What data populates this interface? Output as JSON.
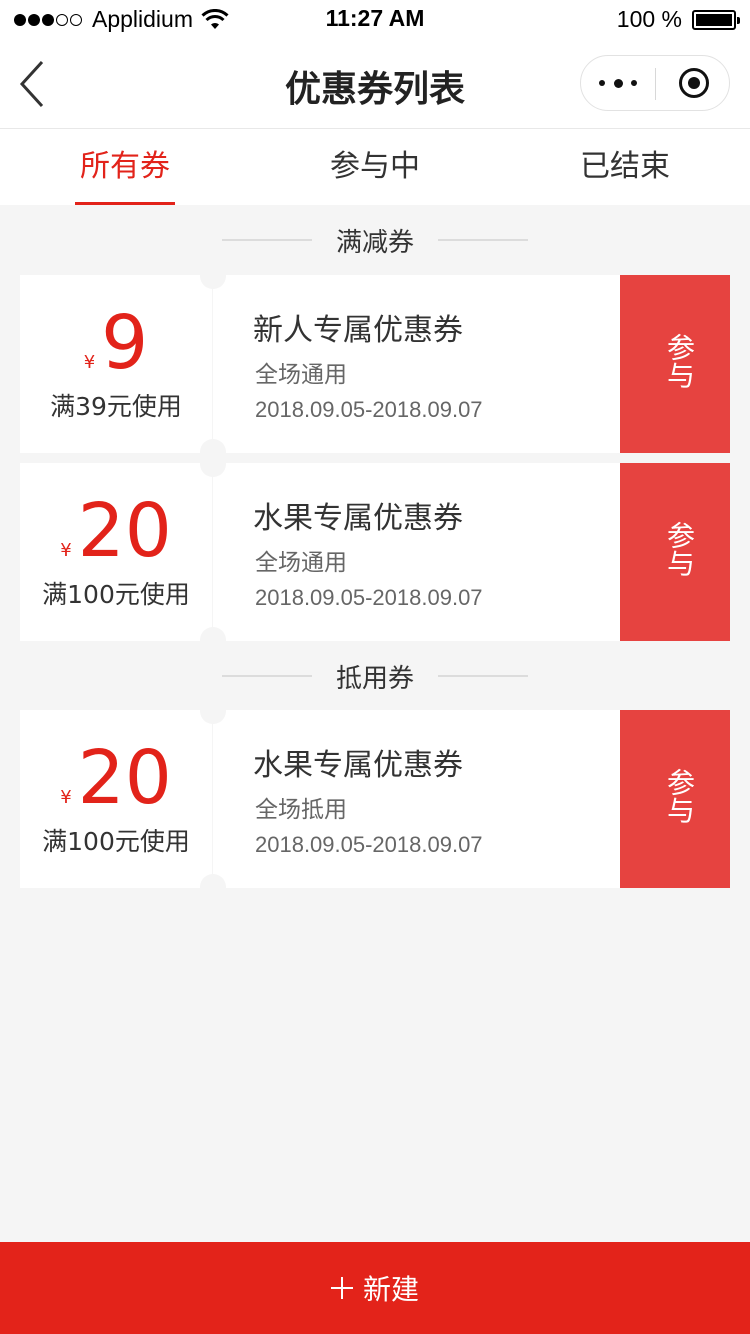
{
  "status_bar": {
    "carrier": "Applidium",
    "time": "11:27 AM",
    "battery": "100 %",
    "battery_level": 1.0,
    "signal_bars_filled": 3,
    "signal_bars_total": 5
  },
  "nav": {
    "title": "优惠券列表",
    "back_icon": "chevron-left-icon",
    "more_icon": "more-dots-icon",
    "close_icon": "target-circle-icon"
  },
  "tabs": [
    {
      "label": "所有券",
      "active": true
    },
    {
      "label": "参与中",
      "active": false
    },
    {
      "label": "已结束",
      "active": false
    }
  ],
  "sections": [
    {
      "title": "满减券",
      "coupons": [
        {
          "currency": "¥",
          "amount": "9",
          "condition": "满39元使用",
          "name": "新人专属优惠券",
          "scope": "全场通用",
          "dates": "2018.09.05-2018.09.07",
          "action": "参与"
        },
        {
          "currency": "¥",
          "amount": "20",
          "condition": "满100元使用",
          "name": "水果专属优惠券",
          "scope": "全场通用",
          "dates": "2018.09.05-2018.09.07",
          "action": "参与"
        }
      ]
    },
    {
      "title": "抵用券",
      "coupons": [
        {
          "currency": "¥",
          "amount": "20",
          "condition": "满100元使用",
          "name": "水果专属优惠券",
          "scope": "全场抵用",
          "dates": "2018.09.05-2018.09.07",
          "action": "参与"
        }
      ]
    }
  ],
  "bottom_button": {
    "label": "新建",
    "icon": "plus-icon"
  },
  "colors": {
    "accent": "#e2231a",
    "action_bg": "#e64340",
    "page_bg": "#f5f5f5"
  }
}
